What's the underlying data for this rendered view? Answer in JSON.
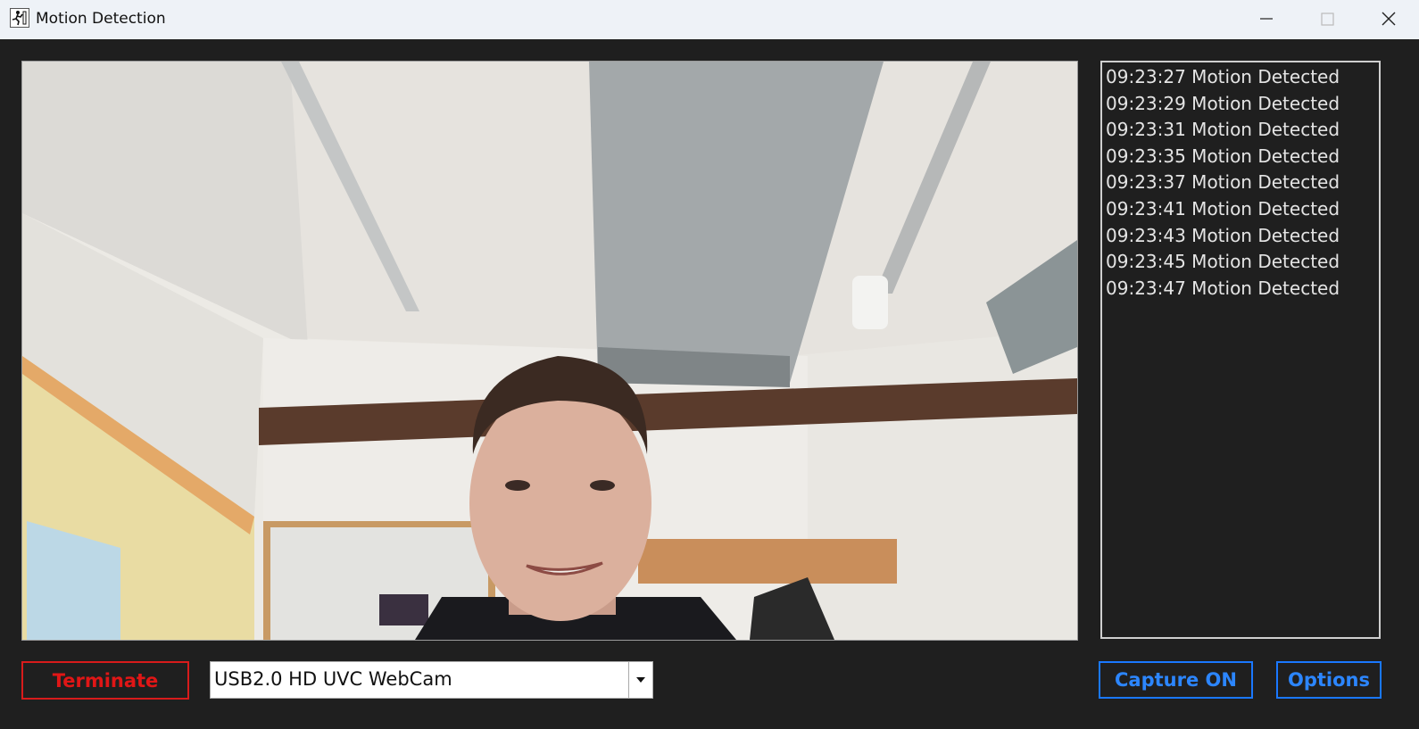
{
  "window": {
    "title": "Motion Detection",
    "icon": "running-person-icon",
    "controls": [
      "minimize-icon",
      "maximize-icon",
      "close-icon"
    ]
  },
  "video": {
    "content": "webcam-feed"
  },
  "log": {
    "entries": [
      "09:23:27 Motion Detected",
      "09:23:29 Motion Detected",
      "09:23:31 Motion Detected",
      "09:23:35 Motion Detected",
      "09:23:37 Motion Detected",
      "09:23:41 Motion Detected",
      "09:23:43 Motion Detected",
      "09:23:45 Motion Detected",
      "09:23:47 Motion Detected"
    ]
  },
  "controls": {
    "terminate_label": "Terminate",
    "camera_select": {
      "value": "USB2.0 HD UVC WebCam",
      "icon": "dropdown-arrow-icon"
    },
    "capture_label": "Capture ON",
    "options_label": "Options"
  },
  "colors": {
    "background": "#1f1f1f",
    "titlebar": "#eef2f7",
    "terminate": "#e01616",
    "accent": "#1a78ff"
  }
}
